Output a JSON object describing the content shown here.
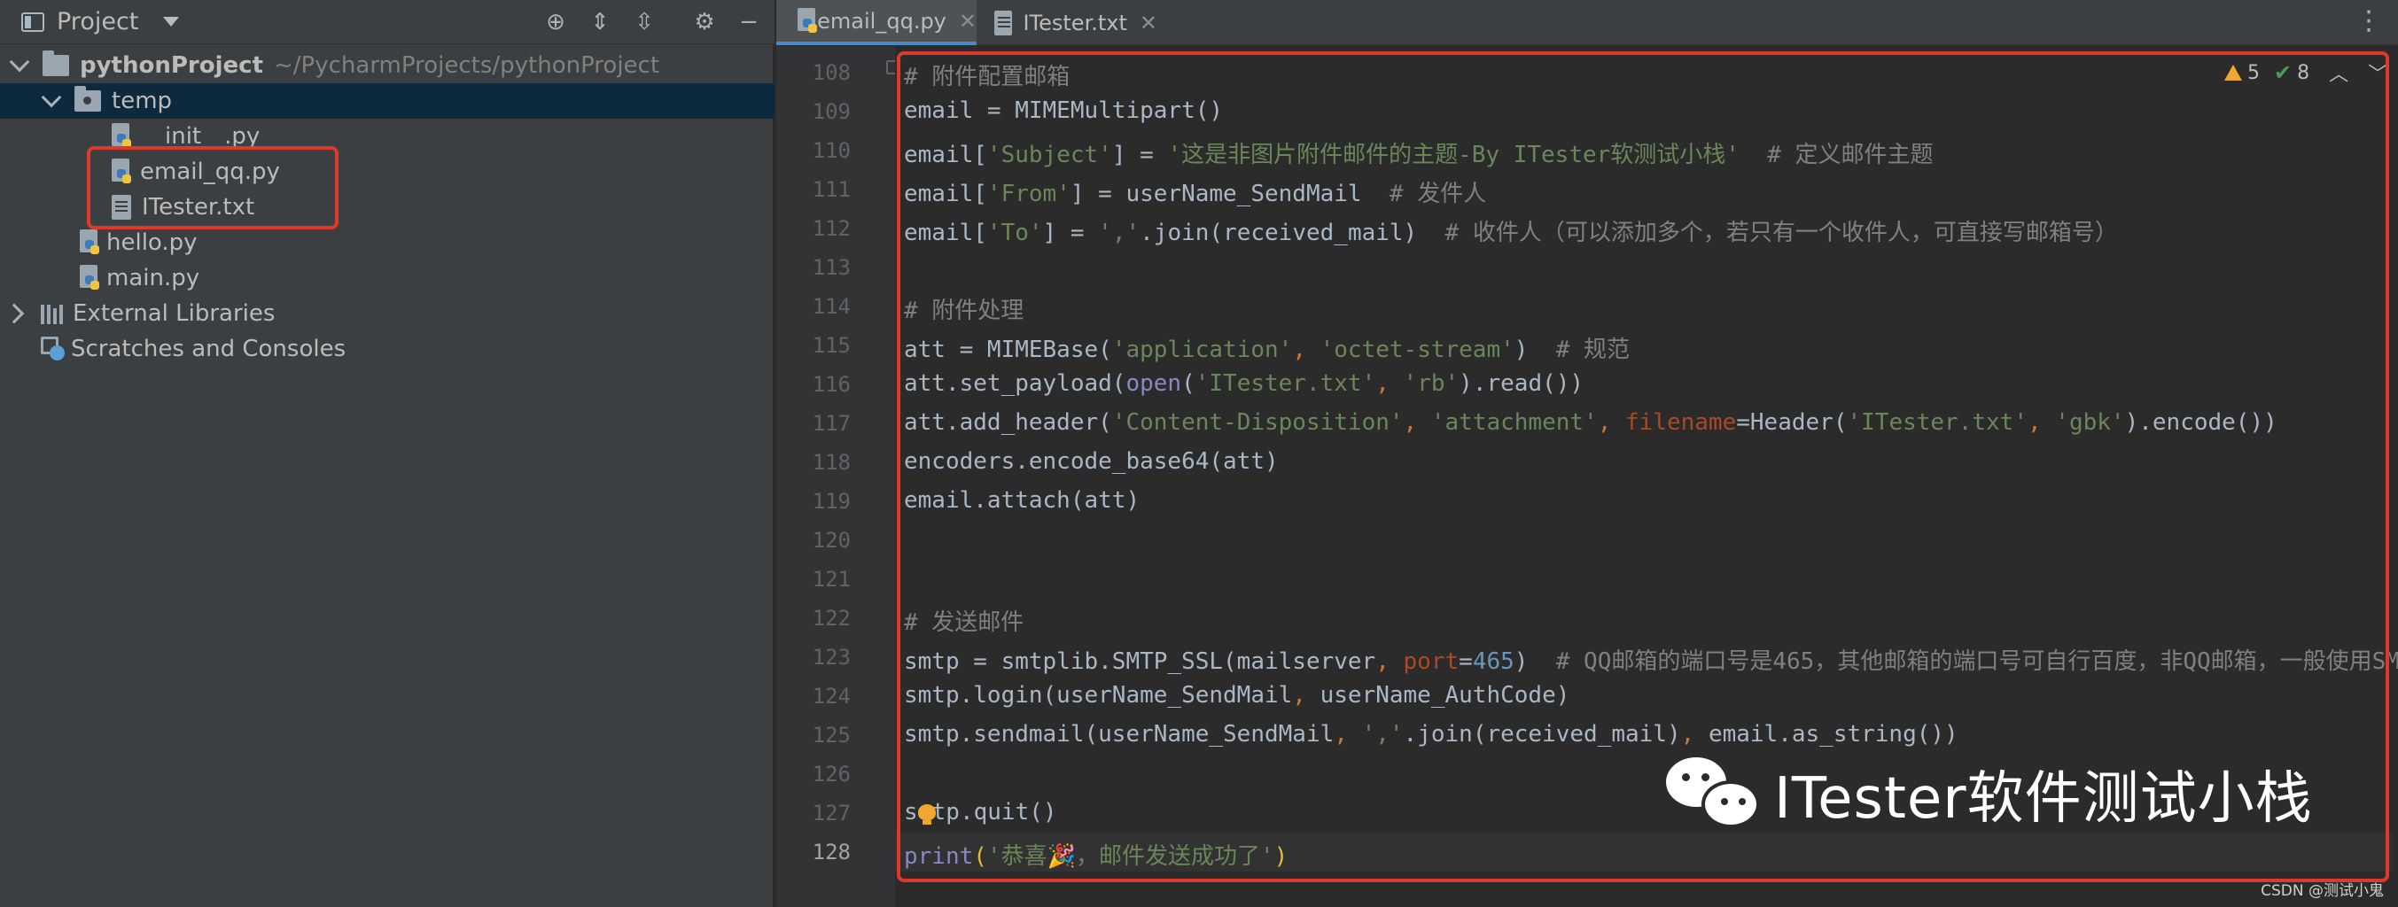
{
  "project_panel": {
    "title": "Project",
    "tree": [
      {
        "label": "pythonProject",
        "path": "~/PycharmProjects/pythonProject"
      },
      {
        "label": "temp"
      },
      {
        "label": "__init__.py"
      },
      {
        "label": "email_qq.py"
      },
      {
        "label": "ITester.txt"
      },
      {
        "label": "hello.py"
      },
      {
        "label": "main.py"
      },
      {
        "label": "External Libraries"
      },
      {
        "label": "Scratches and Consoles"
      }
    ]
  },
  "tabs": [
    {
      "label": "email_qq.py",
      "active": true
    },
    {
      "label": "ITester.txt",
      "active": false
    }
  ],
  "inspection": {
    "warnings": "5",
    "checks": "8"
  },
  "line_numbers": [
    "108",
    "109",
    "110",
    "111",
    "112",
    "113",
    "114",
    "115",
    "116",
    "117",
    "118",
    "119",
    "120",
    "121",
    "122",
    "123",
    "124",
    "125",
    "126",
    "127",
    "128"
  ],
  "code": {
    "l108": {
      "cmt": "# 附件配置邮箱"
    },
    "l109": {
      "a": "email = MIMEMultipart()"
    },
    "l110": {
      "a": "email[",
      "s1": "'Subject'",
      "b": "] = ",
      "s2": "'这是非图片附件邮件的主题-By ITester软测试小栈'",
      "cmt": "  # 定义邮件主题"
    },
    "l111": {
      "a": "email[",
      "s1": "'From'",
      "b": "] = userName_SendMail",
      "cmt": "  # 发件人"
    },
    "l112": {
      "a": "email[",
      "s1": "'To'",
      "b": "] = ",
      "s2": "','",
      "c": ".join(received_mail)",
      "cmt": "  # 收件人（可以添加多个，若只有一个收件人，可直接写邮箱号）"
    },
    "l114": {
      "cmt": "# 附件处理"
    },
    "l115": {
      "a": "att = MIMEBase(",
      "s1": "'application'",
      "k1": ", ",
      "s2": "'octet-stream'",
      "b": ")",
      "cmt": "  # 规范"
    },
    "l116": {
      "a": "att.set_payload(",
      "bi": "open",
      "b": "(",
      "s1": "'ITester.txt'",
      "k1": ", ",
      "s2": "'rb'",
      "c": ").read())"
    },
    "l117": {
      "a": "att.add_header(",
      "s1": "'Content-Disposition'",
      "k1": ", ",
      "s2": "'attachment'",
      "k2": ", ",
      "arg": "filename",
      "b": "=Header(",
      "s3": "'ITester.txt'",
      "k3": ", ",
      "s4": "'gbk'",
      "c": ").encode())"
    },
    "l118": {
      "a": "encoders.encode_base64(att)"
    },
    "l119": {
      "a": "email.attach(att)"
    },
    "l122": {
      "cmt": "# 发送邮件"
    },
    "l123": {
      "a": "smtp = smtplib.SMTP_SSL(mailserver",
      "k1": ", ",
      "arg": "port",
      "b": "=",
      "num": "465",
      "c": ")",
      "cmt": "  # QQ邮箱的端口号是465，其他邮箱的端口号可自行百度，非QQ邮箱，一般使用SM"
    },
    "l124": {
      "a": "smtp.login(userName_SendMail",
      "k1": ", ",
      "b": "userName_AuthCode)"
    },
    "l125": {
      "a": "smtp.sendmail(userName_SendMail",
      "k1": ", ",
      "s1": "','",
      "b": ".join(received_mail)",
      "k2": ", ",
      "c": "email.as_string())"
    },
    "l127": {
      "a": "s",
      "b": "tp.quit()"
    },
    "l128": {
      "bi": "print",
      "p1": "(",
      "s1": "'恭喜🎉，邮件发送成功了'",
      "p2": ")"
    }
  },
  "watermark": {
    "text": "ITester软件测试小栈",
    "credit": "CSDN @测试小鬼"
  },
  "colors": {
    "highlight": "#e0392c",
    "comment": "#808080",
    "string": "#6a8759",
    "keyword": "#cc7832",
    "number": "#6897bb",
    "builtin": "#8888c6",
    "argument": "#aa4926"
  }
}
